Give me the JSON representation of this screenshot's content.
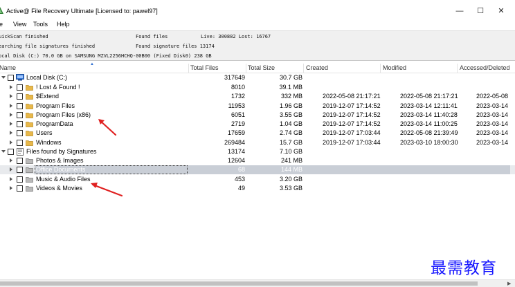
{
  "window": {
    "title": "Active@ File Recovery Ultimate [Licensed to: pawel97]",
    "minimize": "—",
    "maximize": "☐",
    "close": "✕"
  },
  "menu": [
    "le",
    "View",
    "Tools",
    "Help"
  ],
  "status": {
    "line1_left": "uickScan finished",
    "line1_found": "Found files",
    "line1_live": "Live: 300882 Lost: 16767",
    "line2_left": "earching file signatures finished",
    "line2_found": "Found signature files  13174",
    "line3": "ocal Disk (C:) 70.0 GB on SAMSUNG MZVL2256HCHQ-00B00 (Fixed Disk0) 238 GB"
  },
  "columns": {
    "name": "Name",
    "total_files": "Total Files",
    "total_size": "Total Size",
    "created": "Created",
    "modified": "Modified",
    "accessed": "Accessed/Deleted"
  },
  "rows": [
    {
      "name": "Local Disk (C:)",
      "files": "317649",
      "size": "30.7 GB",
      "created": "",
      "modified": "",
      "accessed": ""
    },
    {
      "name": "! Lost & Found !",
      "files": "8010",
      "size": "39.1 MB",
      "created": "",
      "modified": "",
      "accessed": ""
    },
    {
      "name": "$Extend",
      "files": "1732",
      "size": "332 MB",
      "created": "2022-05-08 21:17:21",
      "modified": "2022-05-08 21:17:21",
      "accessed": "2022-05-08"
    },
    {
      "name": "Program Files",
      "files": "11953",
      "size": "1.96 GB",
      "created": "2019-12-07 17:14:52",
      "modified": "2023-03-14 12:11:41",
      "accessed": "2023-03-14"
    },
    {
      "name": "Program Files (x86)",
      "files": "6051",
      "size": "3.55 GB",
      "created": "2019-12-07 17:14:52",
      "modified": "2023-03-14 11:40:28",
      "accessed": "2023-03-14"
    },
    {
      "name": "ProgramData",
      "files": "2719",
      "size": "1.04 GB",
      "created": "2019-12-07 17:14:52",
      "modified": "2023-03-14 11:00:25",
      "accessed": "2023-03-14"
    },
    {
      "name": "Users",
      "files": "17659",
      "size": "2.74 GB",
      "created": "2019-12-07 17:03:44",
      "modified": "2022-05-08 21:39:49",
      "accessed": "2023-03-14"
    },
    {
      "name": "Windows",
      "files": "269484",
      "size": "15.7 GB",
      "created": "2019-12-07 17:03:44",
      "modified": "2023-03-10 18:00:30",
      "accessed": "2023-03-14"
    },
    {
      "name": "Files found by Signatures",
      "files": "13174",
      "size": "7.10 GB",
      "created": "",
      "modified": "",
      "accessed": ""
    },
    {
      "name": "Photos & Images",
      "files": "12604",
      "size": "241 MB",
      "created": "",
      "modified": "",
      "accessed": ""
    },
    {
      "name": "Office Documents",
      "files": "68",
      "size": "144 MB",
      "created": "",
      "modified": "",
      "accessed": ""
    },
    {
      "name": "Music & Audio Files",
      "files": "453",
      "size": "3.20 GB",
      "created": "",
      "modified": "",
      "accessed": ""
    },
    {
      "name": "Videos & Movies",
      "files": "49",
      "size": "3.53 GB",
      "created": "",
      "modified": "",
      "accessed": ""
    }
  ],
  "colors": {
    "folder": "#e8b84a",
    "annotation_arrow": "#e02020",
    "watermark": "#1a1aff",
    "selection": "#c9ced6"
  },
  "watermark": "最需教育"
}
